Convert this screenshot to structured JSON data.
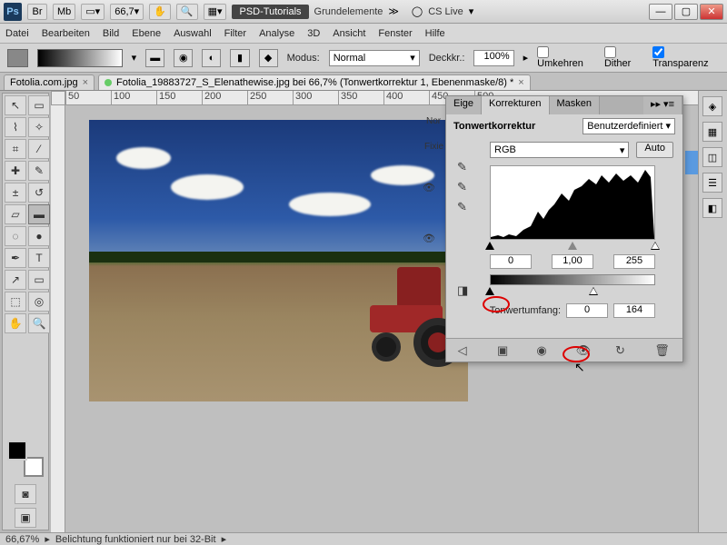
{
  "titlebar": {
    "zoom": "66,7",
    "tag": "PSD-Tutorials",
    "workspace": "Grundelemente",
    "cslive": "CS Live"
  },
  "menu": [
    "Datei",
    "Bearbeiten",
    "Bild",
    "Ebene",
    "Auswahl",
    "Filter",
    "Analyse",
    "3D",
    "Ansicht",
    "Fenster",
    "Hilfe"
  ],
  "options": {
    "modus_label": "Modus:",
    "modus_value": "Normal",
    "opacity_label": "Deckkr.:",
    "opacity_value": "100%",
    "reverse": "Umkehren",
    "dither": "Dither",
    "transparency": "Transparenz"
  },
  "tabs": {
    "t1": "Fotolia.com.jpg",
    "t2": "Fotolia_19883727_S_Elenathewise.jpg bei 66,7%  (Tonwertkorrektur 1, Ebenenmaske/8) *"
  },
  "ruler_marks": [
    "50",
    "100",
    "150",
    "200",
    "250",
    "300",
    "350",
    "400",
    "450",
    "500"
  ],
  "panel": {
    "tab_eigen": "Eige",
    "tab_korr": "Korrekturen",
    "tab_mask": "Masken",
    "nor": "Nor",
    "fixie": "Fixie",
    "title": "Tonwertkorrektur",
    "preset": "Benutzerdefiniert",
    "channel": "RGB",
    "auto": "Auto",
    "in_black": "0",
    "in_gamma": "1,00",
    "in_white": "255",
    "out_label": "Tonwertumfang:",
    "out_black": "0",
    "out_white": "164"
  },
  "status": {
    "zoom": "66,67%",
    "msg": "Belichtung funktioniert nur bei 32-Bit"
  }
}
